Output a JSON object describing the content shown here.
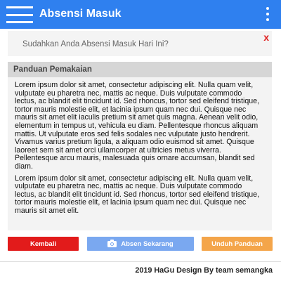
{
  "appbar": {
    "title": "Absensi Masuk",
    "menu_icon": "hamburger-menu-icon",
    "more_icon": "more-vertical-icon"
  },
  "notice": {
    "text": "Sudahkan Anda Absensi Masuk Hari Ini?",
    "close_label": "x"
  },
  "guide": {
    "title": "Panduan Pemakaian",
    "paragraphs": [
      "Lorem ipsum dolor sit amet, consectetur adipiscing elit. Nulla quam velit, vulputate eu pharetra nec, mattis ac neque. Duis vulputate commodo lectus, ac blandit elit tincidunt id. Sed rhoncus, tortor sed eleifend tristique, tortor mauris molestie elit, et lacinia ipsum quam nec dui. Quisque nec mauris sit amet elit iaculis pretium sit amet quis magna. Aenean velit odio, elementum in tempus ut, vehicula eu diam. Pellentesque rhoncus aliquam mattis. Ut vulputate eros sed felis sodales nec vulputate justo hendrerit. Vivamus varius pretium ligula, a aliquam odio euismod sit amet. Quisque laoreet sem sit amet orci ullamcorper at ultricies metus viverra. Pellentesque arcu mauris, malesuada quis ornare accumsan, blandit sed diam.",
      "Lorem ipsum dolor sit amet, consectetur adipiscing elit. Nulla quam velit, vulputate eu pharetra nec, mattis ac neque. Duis vulputate commodo lectus, ac blandit elit tincidunt id. Sed rhoncus, tortor sed eleifend tristique, tortor mauris molestie elit, et lacinia ipsum quam nec dui. Quisque nec mauris sit amet elit."
    ]
  },
  "actions": {
    "back_label": "Kembali",
    "absen_label": "Absen Sekarang",
    "absen_icon": "camera-icon",
    "download_label": "Unduh Panduan"
  },
  "footer": {
    "text": "2019 HaGu Design By team semangka"
  },
  "colors": {
    "primary": "#2f80ef",
    "danger": "#e21b1b",
    "absen": "#7aa8f0",
    "warning": "#f4a54a"
  }
}
